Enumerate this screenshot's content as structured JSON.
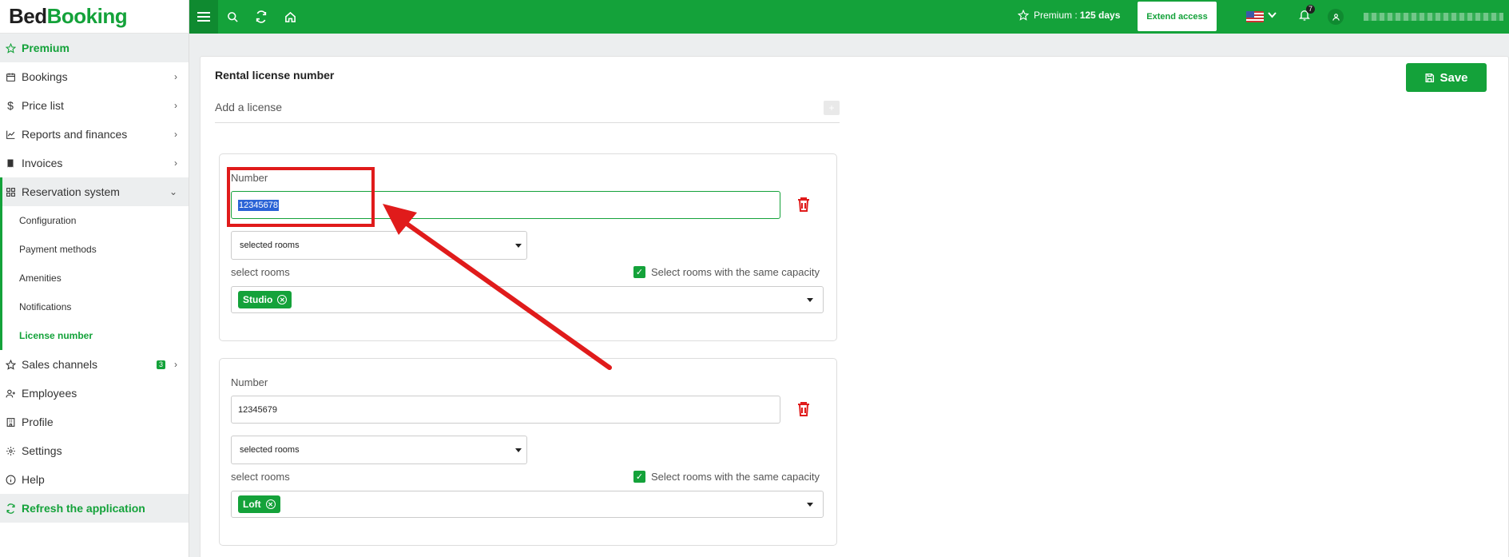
{
  "brand": {
    "part1": "Bed",
    "part2": "Booking"
  },
  "sidebar": {
    "premium": "Premium",
    "items": [
      {
        "label": "Bookings"
      },
      {
        "label": "Price list"
      },
      {
        "label": "Reports and finances"
      },
      {
        "label": "Invoices"
      },
      {
        "label": "Reservation system"
      }
    ],
    "sub_items": [
      {
        "label": "Configuration"
      },
      {
        "label": "Payment methods"
      },
      {
        "label": "Amenities"
      },
      {
        "label": "Notifications"
      },
      {
        "label": "License number"
      }
    ],
    "lower_items": [
      {
        "label": "Sales channels",
        "badge": "3"
      },
      {
        "label": "Employees"
      },
      {
        "label": "Profile"
      },
      {
        "label": "Settings"
      },
      {
        "label": "Help"
      }
    ],
    "refresh": "Refresh the application"
  },
  "topbar": {
    "premium_label": "Premium :",
    "premium_days": "125 days",
    "extend_label": "Extend access",
    "notifications_count": "7"
  },
  "page": {
    "title": "Rental license number",
    "save_label": "Save",
    "add_license_label": "Add a license",
    "add_plus": "+"
  },
  "licenses": [
    {
      "number_label": "Number",
      "number_value": "12345678",
      "room_mode": "selected rooms",
      "select_rooms_label": "select rooms",
      "same_capacity_label": "Select rooms with the same capacity",
      "rooms": [
        "Studio"
      ]
    },
    {
      "number_label": "Number",
      "number_value": "12345679",
      "room_mode": "selected rooms",
      "select_rooms_label": "select rooms",
      "same_capacity_label": "Select rooms with the same capacity",
      "rooms": [
        "Loft"
      ]
    }
  ],
  "colors": {
    "brand_green": "#14a23a",
    "annotation_red": "#e01b1b",
    "selection_blue": "#2a63d6"
  }
}
